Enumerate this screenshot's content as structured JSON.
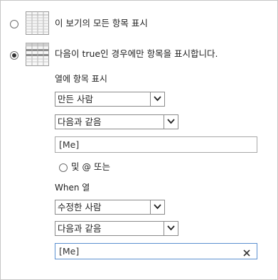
{
  "view_options": {
    "show_all_label": "이 보기의 모든 항목 표시",
    "show_filtered_label": "다음이 true인 경우에만 항목을 표시합니다.",
    "selected": "show_filtered"
  },
  "filter1": {
    "section_label": "열에 항목 표시",
    "column_value": "만든 사람",
    "operator_value": "다음과 같음",
    "value": "[Me]"
  },
  "connector": {
    "and_or_label": "및 @ 또는"
  },
  "filter2": {
    "section_label": "When 열",
    "column_value": "수정한 사람",
    "operator_value": "다음과 같음",
    "value": "[Me]"
  },
  "colors": {
    "border": "#8a8a8a",
    "focus_border": "#5a8fd0",
    "text": "#222222"
  },
  "icons": {
    "all_items": "list-grid-icon",
    "filtered_items": "filtered-list-icon",
    "dropdown": "chevron-down-icon",
    "clear": "close-icon"
  }
}
